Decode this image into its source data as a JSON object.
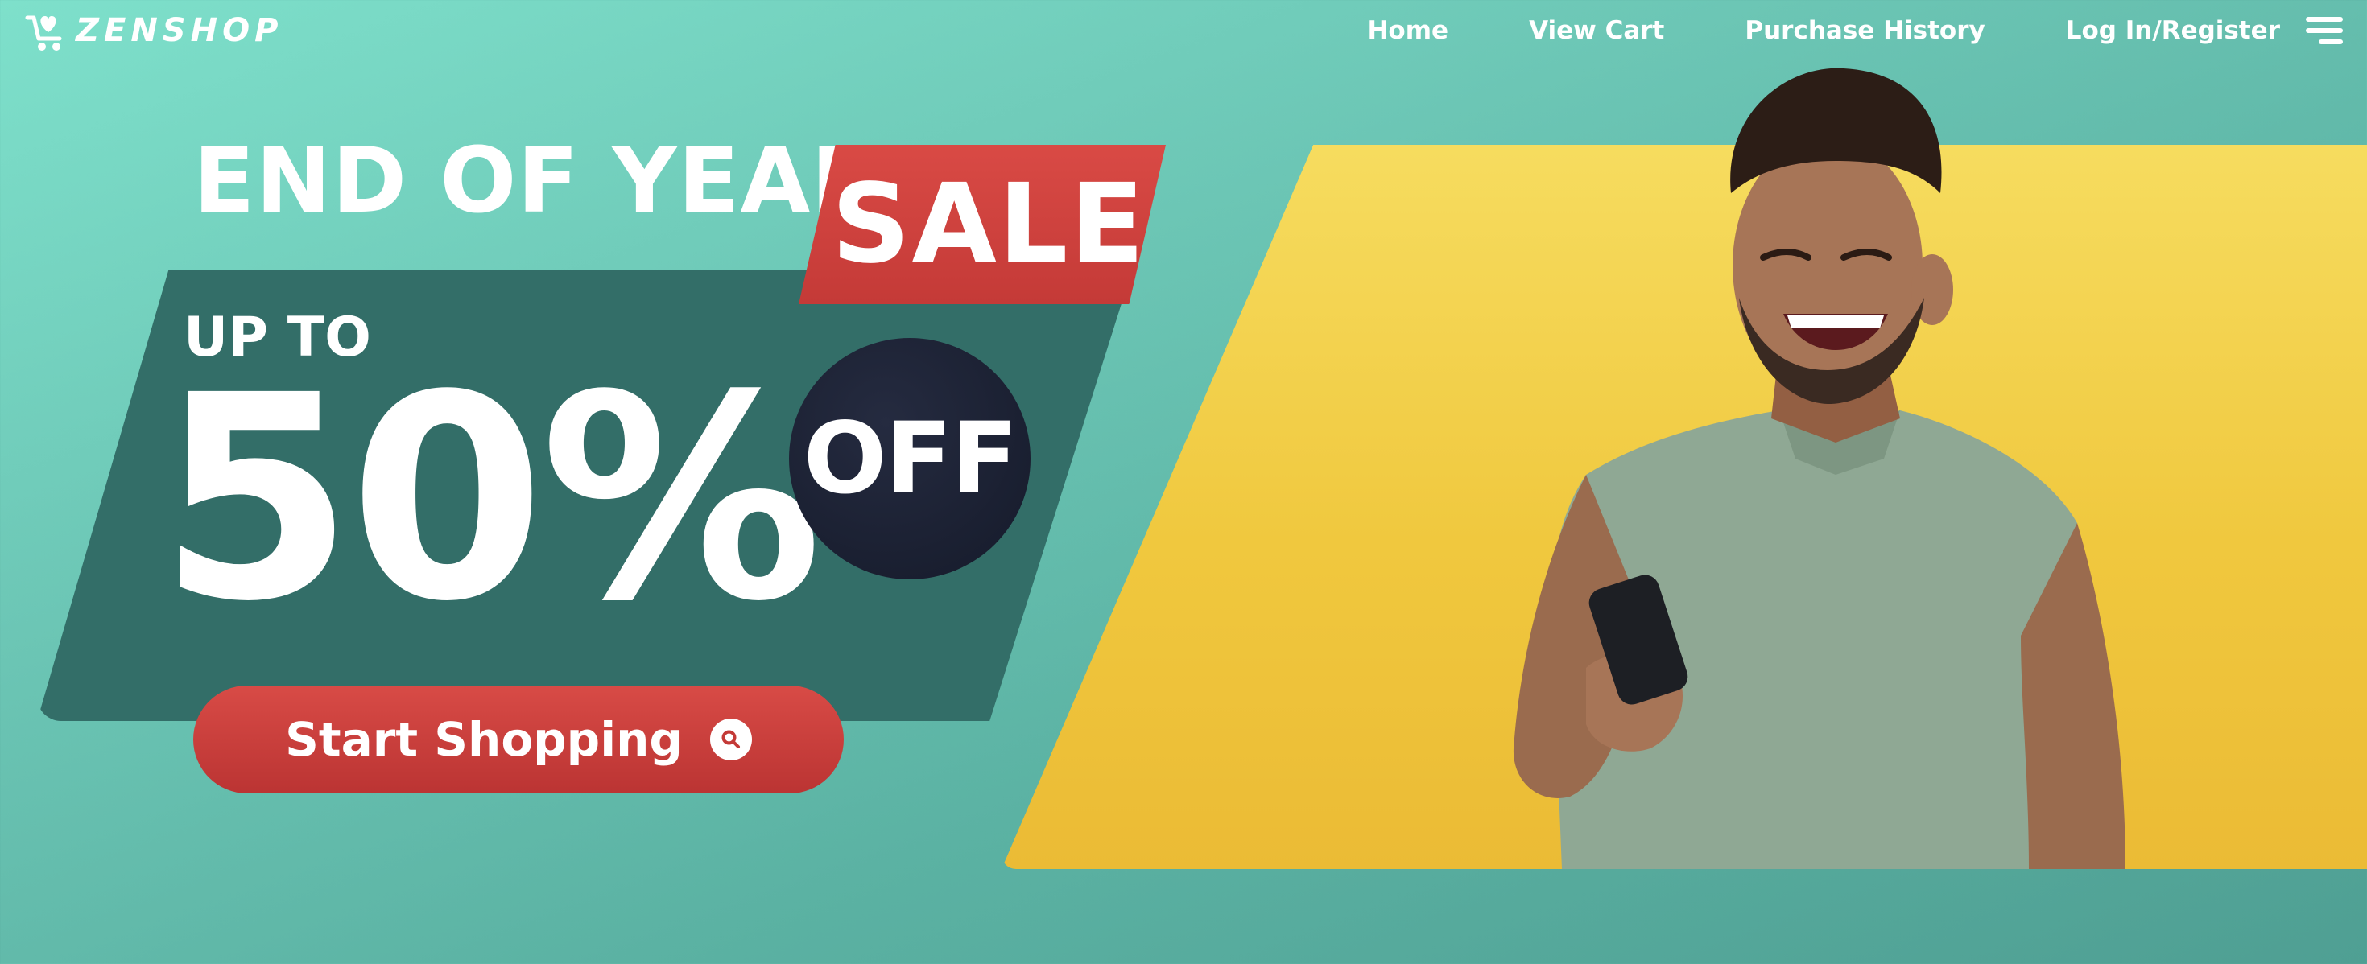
{
  "brand": {
    "name": "ZENSHOP",
    "icon": "shopping-cart-heart-icon"
  },
  "nav": {
    "items": [
      {
        "label": "Home"
      },
      {
        "label": "View Cart"
      },
      {
        "label": "Purchase History"
      },
      {
        "label": "Log In/Register"
      }
    ],
    "menu_icon": "hamburger-menu-icon"
  },
  "banner": {
    "headline": "END OF YEAR",
    "sale": "SALE",
    "upto": "UP TO",
    "discount": "50%",
    "off": "OFF",
    "cta": {
      "label": "Start Shopping",
      "icon": "search-icon"
    },
    "hero_image": "man-smiling-at-phone"
  },
  "colors": {
    "background_start": "#7ee0cb",
    "background_end": "#4f9f93",
    "panel_dark": "#336e68",
    "sale_red": "#d94a45",
    "off_dark": "#151a2a",
    "accent_yellow": "#f3d050",
    "text_white": "#ffffff"
  }
}
